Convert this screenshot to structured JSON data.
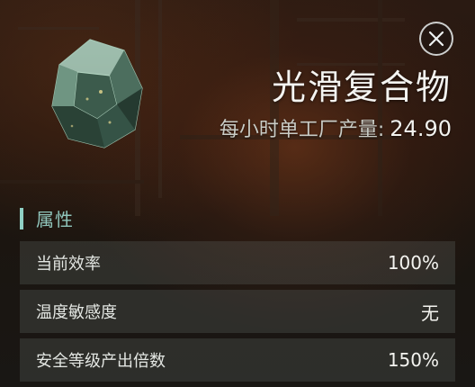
{
  "item": {
    "name": "光滑复合物",
    "rate_label": "每小时单工厂产量:",
    "rate_value": "24.90",
    "icon": "green-crystal-gem-icon"
  },
  "close_icon": "close-icon",
  "attributes": {
    "title": "属性",
    "rows": [
      {
        "label": "当前效率",
        "value": "100%"
      },
      {
        "label": "温度敏感度",
        "value": "无"
      },
      {
        "label": "安全等级产出倍数",
        "value": "150%"
      }
    ]
  },
  "colors": {
    "accent": "#8fd0c4",
    "title_text": "#f4f4f1",
    "row_bg": "rgba(120,132,126,0.22)"
  }
}
